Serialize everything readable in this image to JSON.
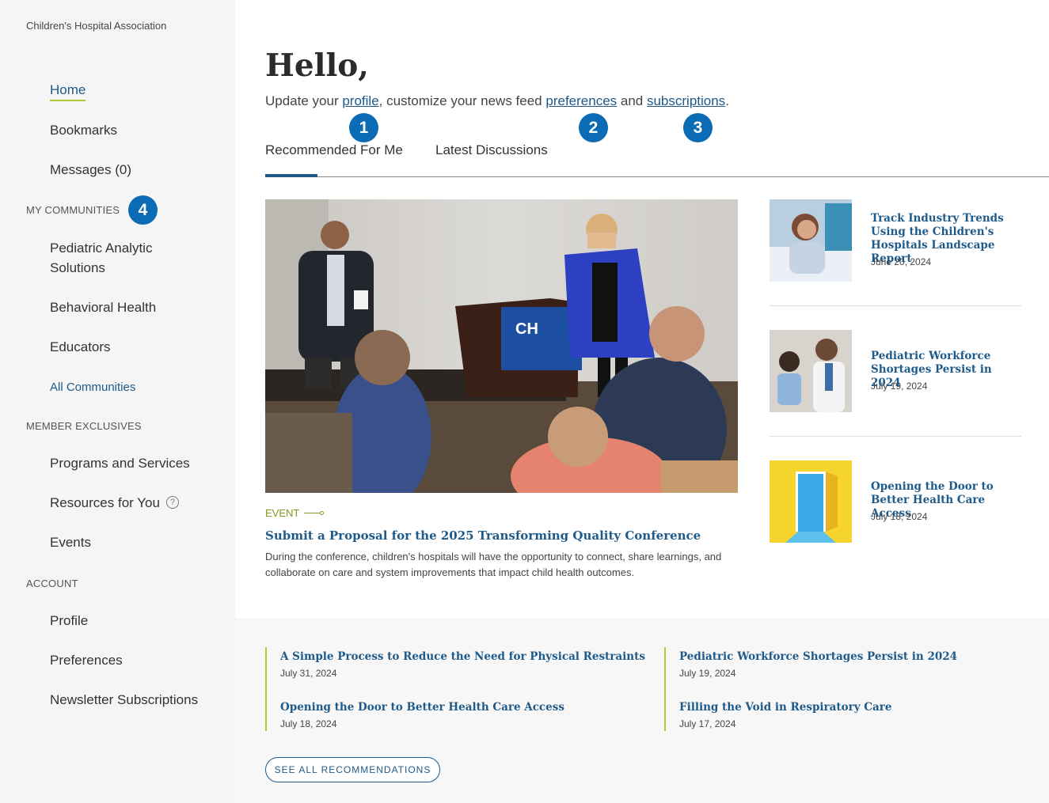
{
  "sidebar": {
    "org_name": "Children's Hospital Association",
    "nav": {
      "home": "Home",
      "bookmarks": "Bookmarks",
      "messages": "Messages (0)"
    },
    "my_communities": {
      "label": "MY COMMUNITIES",
      "items": [
        "Pediatric Analytic",
        "Solutions",
        "Behavioral Health",
        "Educators"
      ],
      "all_link": "All Communities"
    },
    "member_exclusives": {
      "label": "MEMBER EXCLUSIVES",
      "items": [
        "Programs and Services",
        "Resources for You",
        "Events"
      ],
      "help_glyph": "?"
    },
    "account": {
      "label": "ACCOUNT",
      "items": [
        "Profile",
        "Preferences",
        "Newsletter Subscriptions"
      ]
    }
  },
  "badges": [
    "1",
    "2",
    "3",
    "4"
  ],
  "greeting": {
    "title": "Hello,",
    "prefix": "Update your ",
    "profile_link": "profile",
    "middle": ", customize your news feed ",
    "preferences_link": "preferences",
    "and": " and ",
    "subscriptions_link": "subscriptions",
    "suffix": "."
  },
  "tabs": [
    "Recommended For Me",
    "Latest Discussions"
  ],
  "featured": {
    "category": "EVENT",
    "title": "Submit a Proposal for the 2025 Transforming Quality Conference",
    "description": "During the conference, children's hospitals will have the opportunity to connect, share learnings, and collaborate on care and system improvements that impact child health outcomes.",
    "podium_logo": "CH"
  },
  "side_articles": [
    {
      "title": "Track Industry Trends Using the Children's Hospitals Landscape Report",
      "date": "June 20, 2024"
    },
    {
      "title": "Pediatric Workforce Shortages Persist in 2024",
      "date": "July 19, 2024"
    },
    {
      "title": "Opening the Door to Better Health Care Access",
      "date": "July 18, 2024"
    }
  ],
  "recommendations": [
    {
      "title": "A Simple Process to Reduce the Need for Physical Restraints",
      "date": "July 31, 2024"
    },
    {
      "title": "Opening the Door to Better Health Care Access",
      "date": "July 18, 2024"
    },
    {
      "title": "Pediatric Workforce Shortages Persist in 2024",
      "date": "July 19, 2024"
    },
    {
      "title": "Filling the Void in Respiratory Care",
      "date": "July 17, 2024"
    }
  ],
  "see_all_label": "SEE ALL RECOMMENDATIONS",
  "colors": {
    "link_blue": "#1e5a8a",
    "badge_blue": "#0b6bb5",
    "accent_green": "#b5c832",
    "sidebar_bg": "#f5f5f5"
  }
}
